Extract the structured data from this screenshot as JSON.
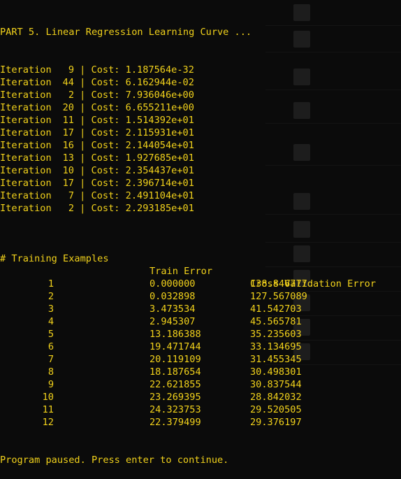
{
  "terminal": {
    "part_title": "PART 5. Linear Regression Learning Curve ...",
    "iteration_label": "Iteration",
    "cost_separator": " | Cost: ",
    "cost_lines": [
      {
        "iter": "9",
        "cost": "1.187564e-32"
      },
      {
        "iter": "44",
        "cost": "6.162944e-02"
      },
      {
        "iter": "2",
        "cost": "7.936046e+00"
      },
      {
        "iter": "20",
        "cost": "6.655211e+00"
      },
      {
        "iter": "11",
        "cost": "1.514392e+01"
      },
      {
        "iter": "17",
        "cost": "2.115931e+01"
      },
      {
        "iter": "16",
        "cost": "2.144054e+01"
      },
      {
        "iter": "13",
        "cost": "1.927685e+01"
      },
      {
        "iter": "10",
        "cost": "2.354437e+01"
      },
      {
        "iter": "17",
        "cost": "2.396714e+01"
      },
      {
        "iter": "7",
        "cost": "2.491104e+01"
      },
      {
        "iter": "2",
        "cost": "2.293185e+01"
      }
    ],
    "table": {
      "headers": [
        "# Training Examples",
        "Train Error",
        "Cross Validation Error"
      ],
      "rows": [
        {
          "m": "1",
          "train": "0.000000",
          "cv": "138.846777"
        },
        {
          "m": "2",
          "train": "0.032898",
          "cv": "127.567089"
        },
        {
          "m": "3",
          "train": "3.473534",
          "cv": "41.542703"
        },
        {
          "m": "4",
          "train": "2.945307",
          "cv": "45.565781"
        },
        {
          "m": "5",
          "train": "13.186388",
          "cv": "35.235603"
        },
        {
          "m": "6",
          "train": "19.471744",
          "cv": "33.134695"
        },
        {
          "m": "7",
          "train": "20.119109",
          "cv": "31.455345"
        },
        {
          "m": "8",
          "train": "18.187654",
          "cv": "30.498301"
        },
        {
          "m": "9",
          "train": "22.621855",
          "cv": "30.837544"
        },
        {
          "m": "10",
          "train": "23.269395",
          "cv": "28.842032"
        },
        {
          "m": "11",
          "train": "24.323753",
          "cv": "29.520505"
        },
        {
          "m": "12",
          "train": "22.379499",
          "cv": "29.376197"
        }
      ]
    },
    "pause_message": "Program paused. Press enter to continue.",
    "text_color": "#f2d21b",
    "background_color": "#0b0b0b"
  }
}
